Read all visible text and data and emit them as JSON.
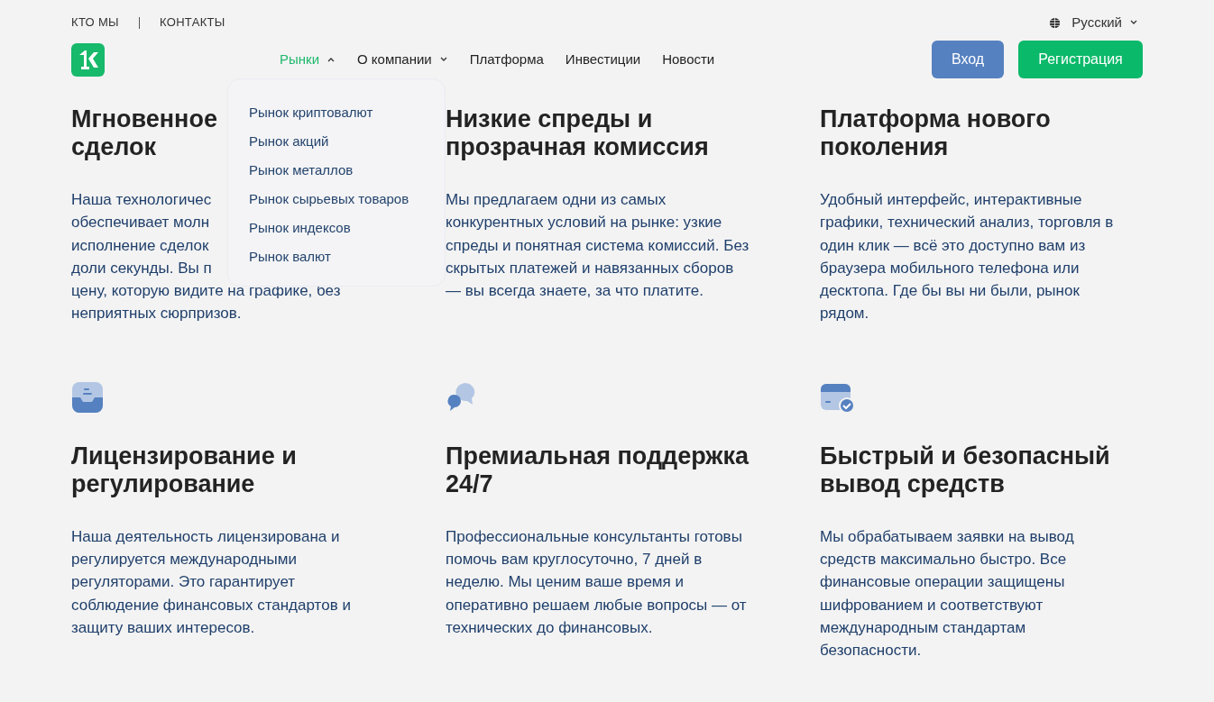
{
  "top_links": [
    "КТО МЫ",
    "КОНТАКТЫ"
  ],
  "language": "Русский",
  "nav": [
    {
      "label": "Рынки",
      "kind": "dropdown",
      "selected": true,
      "expanded": true
    },
    {
      "label": "О компании",
      "kind": "dropdown",
      "selected": false,
      "expanded": false
    },
    {
      "label": "Платформа",
      "kind": "link",
      "selected": false
    },
    {
      "label": "Инвестиции",
      "kind": "link",
      "selected": false
    },
    {
      "label": "Новости",
      "kind": "link",
      "selected": false
    }
  ],
  "dropdown": [
    "Рынок криптовалют",
    "Рынок акций",
    "Рынок металлов",
    "Рынок сырьевых товаров",
    "Рынок индексов",
    "Рынок валют"
  ],
  "buttons": {
    "login": "Вход",
    "register": "Регистрация"
  },
  "features": [
    {
      "kind": "lines",
      "title": [
        "Мгновенное",
        "сделок"
      ],
      "body": [
        "Наша технологичес",
        "обеспечивает молн",
        "исполнение сделок",
        "доли секунды. Вы п",
        "цену, которую видите на графике, без",
        "неприятных сюрпризов."
      ]
    },
    {
      "kind": "text",
      "title": "Низкие спреды и прозрачная комиссия",
      "body": "Мы предлагаем одни из самых конкурентных условий на рынке: узкие спреды и понятная система комиссий. Без скрытых платежей и навязанных сборов — вы всегда знаете, за что платите."
    },
    {
      "kind": "text",
      "title": "Платформа нового поколения",
      "body": "Удобный интерфейс, интерактивные графики, технический анализ, торговля в один клик — всё это доступно вам из браузера мобильного телефона или десктопа. Где бы вы ни были, рынок рядом."
    },
    {
      "kind": "text",
      "title": "Лицензирование и регулирование",
      "body": "Наша деятельность лицензирована и регулируется международными регуляторами. Это гарантирует соблюдение финансовых стандартов и защиту ваших интересов."
    },
    {
      "kind": "text",
      "title": "Премиальная поддержка 24/7",
      "body": "Профессиональные консультанты готовы помочь вам круглосуточно, 7 дней в неделю. Мы ценим ваше время и оперативно решаем любые вопросы — от технических до финансовых."
    },
    {
      "kind": "text",
      "title": "Быстрый и безопасный вывод средств",
      "body": "Мы обрабатываем заявки на вывод средств максимально быстро. Все финансовые операции защищены шифрованием и соответствуют международным стандартам безопасности."
    }
  ]
}
